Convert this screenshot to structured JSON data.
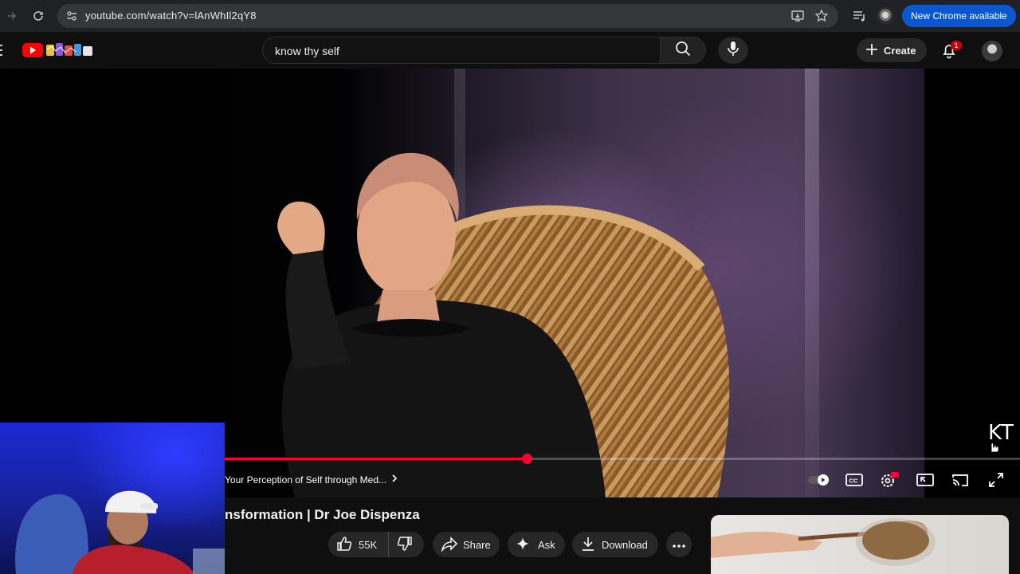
{
  "browser": {
    "url": "youtube.com/watch?v=lAnWhIl2qY8",
    "new_chrome_label": "New Chrome available"
  },
  "header": {
    "search_query": "know thy self",
    "create_label": "Create",
    "notification_count": "1"
  },
  "player": {
    "watermark": "KT",
    "chapter_title": "Your Perception of Self through Med...",
    "progress_fraction": 0.38
  },
  "video": {
    "title": "nsformation | Dr Joe Dispenza",
    "like_count": "55K",
    "share_label": "Share",
    "ask_label": "Ask",
    "download_label": "Download"
  },
  "colors": {
    "accent_red": "#ff0033",
    "chrome_blue": "#0b57d0",
    "background": "#0f0f0f"
  }
}
